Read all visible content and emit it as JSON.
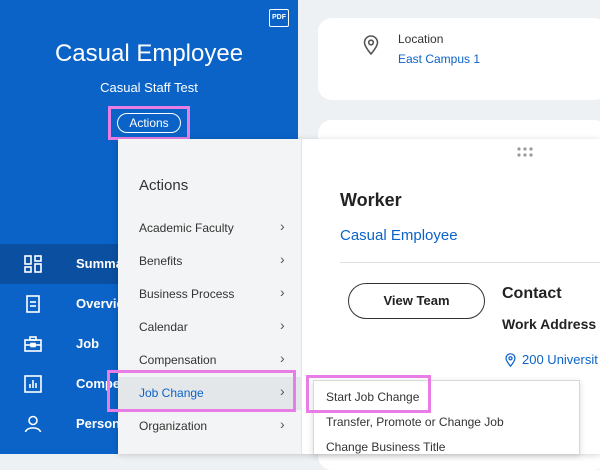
{
  "profile": {
    "pdf_label": "PDF",
    "name": "Casual Employee",
    "subtitle": "Casual Staff Test",
    "actions_label": "Actions"
  },
  "nav": {
    "items": [
      {
        "label": "Summa",
        "icon": "grid-icon",
        "active": true
      },
      {
        "label": "Overvie",
        "icon": "document-icon"
      },
      {
        "label": "Job",
        "icon": "briefcase-icon"
      },
      {
        "label": "Compe",
        "icon": "bar-chart-icon"
      },
      {
        "label": "Person",
        "icon": "person-icon"
      }
    ]
  },
  "location": {
    "label": "Location",
    "value": "East Campus 1",
    "icon": "location-pin-icon"
  },
  "actions_menu": {
    "title": "Actions",
    "items": [
      {
        "label": "Academic Faculty"
      },
      {
        "label": "Benefits"
      },
      {
        "label": "Business Process"
      },
      {
        "label": "Calendar"
      },
      {
        "label": "Compensation"
      },
      {
        "label": "Job Change",
        "selected": true
      },
      {
        "label": "Organization"
      }
    ]
  },
  "worker": {
    "title": "Worker",
    "name": "Casual Employee",
    "view_team_label": "View Team"
  },
  "contact": {
    "title": "Contact",
    "work_address_label": "Work Address",
    "address_link": "200 Universit"
  },
  "submenu": {
    "items": [
      {
        "label": "Start Job Change"
      },
      {
        "label": "Transfer, Promote or Change Job"
      },
      {
        "label": "Change Business Title"
      }
    ]
  },
  "colors": {
    "brand_blue": "#0b63c8",
    "highlight": "#e87de6"
  }
}
